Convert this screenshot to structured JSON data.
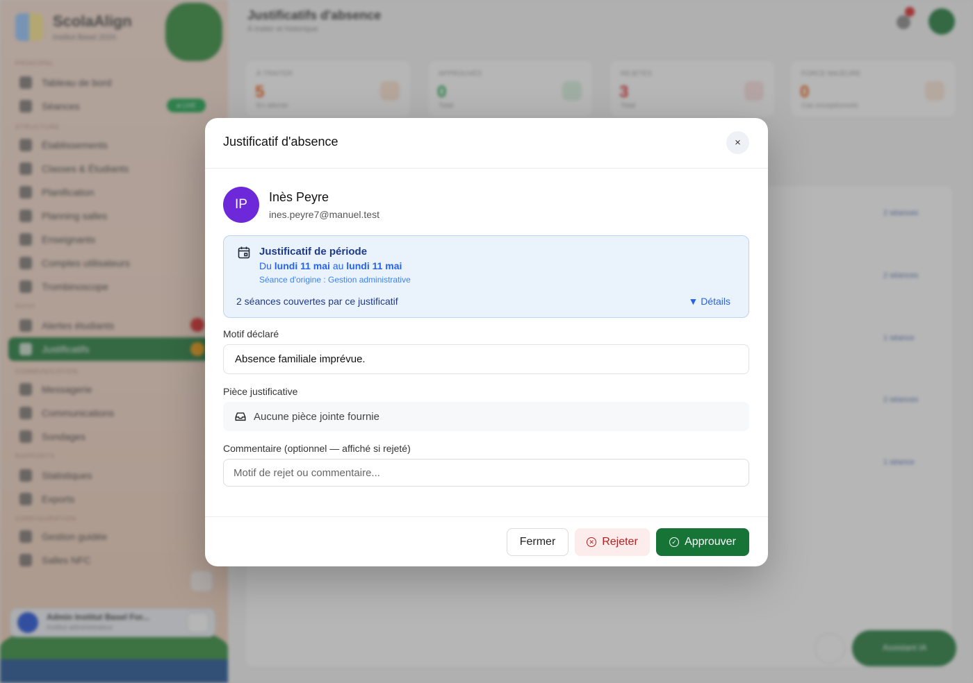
{
  "background": {
    "brand": {
      "title": "ScolaAlign",
      "subtitle": "Institut Basel 2024"
    },
    "sidebar": {
      "sections": [
        "PRINCIPAL",
        "STRUCTURE",
        "SUIVI",
        "COMMUNICATION",
        "RAPPORTS",
        "CONFIGURATION"
      ],
      "items": [
        "Tableau de bord",
        "Séances",
        "Établissements",
        "Classes & Étudiants",
        "Planification",
        "Planning salles",
        "Enseignants",
        "Comptes utilisateurs",
        "Trombinoscope",
        "Alertes étudiants",
        "Justificatifs",
        "Messagerie",
        "Communications",
        "Sondages",
        "Statistiques",
        "Exports",
        "Gestion guidée",
        "Salles NFC"
      ],
      "live_badge": "● LIVE",
      "footer_user": "Admin Institut Basel For...",
      "footer_role": "Institut administrateur"
    },
    "header": {
      "title": "Justificatifs d'absence",
      "subtitle": "À traiter et historique"
    },
    "stats": [
      {
        "label": "À TRAITER",
        "value": "5",
        "sub": "En attente",
        "color": "#ea580c"
      },
      {
        "label": "APPROUVÉS",
        "value": "0",
        "sub": "Total",
        "color": "#16a34a"
      },
      {
        "label": "REJETÉS",
        "value": "3",
        "sub": "Total",
        "color": "#dc2626"
      },
      {
        "label": "FORCE MAJEURE",
        "value": "0",
        "sub": "Cas exceptionnels",
        "color": "#ea580c"
      }
    ],
    "row_tags": [
      "2 séances",
      "2 séances",
      "1 séance",
      "2 séances",
      "1 séance"
    ],
    "assistant_label": "Assistant IA"
  },
  "modal": {
    "title": "Justificatif d'absence",
    "close_symbol": "×",
    "student": {
      "initials": "IP",
      "name": "Inès Peyre",
      "email": "ines.peyre7@manuel.test"
    },
    "period": {
      "title": "Justificatif de période",
      "range_prefix": "Du",
      "start": "lundi 11 mai",
      "range_mid": "au",
      "end": "lundi 11 mai",
      "origin": "Séance d'origine : Gestion administrative",
      "coverage": "2 séances couvertes par ce justificatif",
      "details_label": "▼ Détails"
    },
    "reason": {
      "label": "Motif déclaré",
      "value": "Absence familiale imprévue."
    },
    "attachment": {
      "label": "Pièce justificative",
      "value": "Aucune pièce jointe fournie"
    },
    "comment": {
      "label": "Commentaire (optionnel — affiché si rejeté)",
      "placeholder": "Motif de rejet ou commentaire...",
      "value": ""
    },
    "buttons": {
      "close": "Fermer",
      "reject": "Rejeter",
      "approve": "Approuver"
    },
    "colors": {
      "avatar": "#6d28d9",
      "approve": "#177437",
      "reject_text": "#b91c1c",
      "period_bg": "#eaf2fc"
    }
  }
}
